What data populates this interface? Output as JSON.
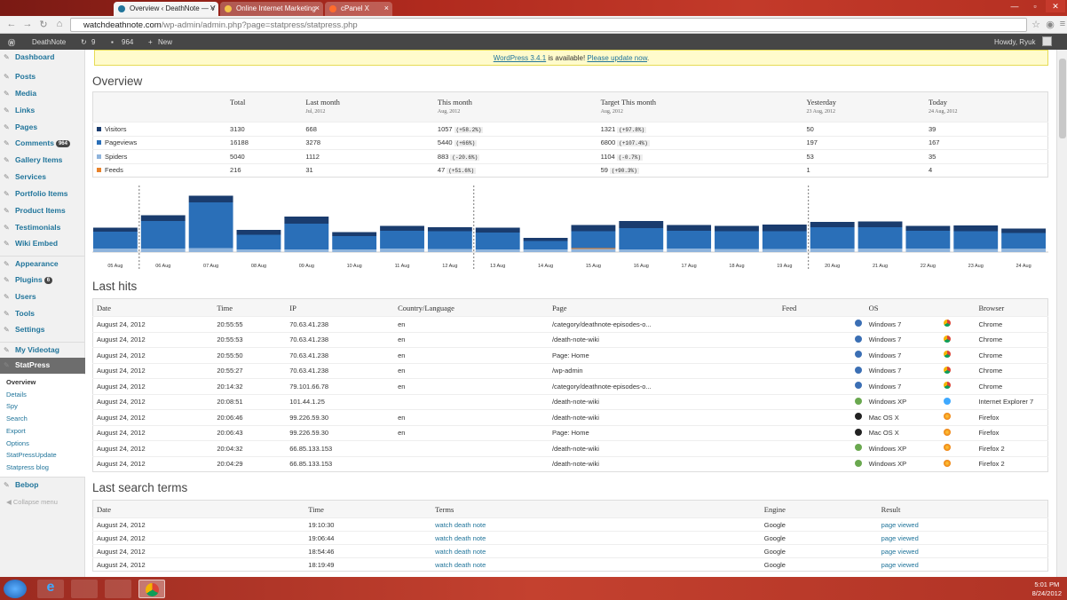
{
  "browser": {
    "tabs": [
      {
        "title": "Overview ‹ DeathNote — V"
      },
      {
        "title": "Online Internet Marketing"
      },
      {
        "title": "cPanel X"
      }
    ],
    "url_host": "watchdeathnote.com",
    "url_path": "/wp-admin/admin.php?page=statpress/statpress.php"
  },
  "adminbar": {
    "site": "DeathNote",
    "updates": "9",
    "comments": "964",
    "new": "New",
    "howdy": "Howdy, Ryuk"
  },
  "sidebar": {
    "items": [
      {
        "label": "Dashboard",
        "icon": "dashboard-icon"
      },
      {
        "label": "Posts",
        "icon": "pin-icon"
      },
      {
        "label": "Media",
        "icon": "media-icon"
      },
      {
        "label": "Links",
        "icon": "links-icon"
      },
      {
        "label": "Pages",
        "icon": "pages-icon"
      },
      {
        "label": "Comments",
        "icon": "comments-icon",
        "badge": "964"
      },
      {
        "label": "Gallery Items",
        "icon": "pin-icon"
      },
      {
        "label": "Services",
        "icon": "pin-icon"
      },
      {
        "label": "Portfolio Items",
        "icon": "pin-icon"
      },
      {
        "label": "Product Items",
        "icon": "pin-icon"
      },
      {
        "label": "Testimonials",
        "icon": "pin-icon"
      },
      {
        "label": "Wiki Embed",
        "icon": "wiki-icon"
      },
      {
        "label": "Appearance",
        "icon": "appearance-icon"
      },
      {
        "label": "Plugins",
        "icon": "plugins-icon",
        "badge": "6"
      },
      {
        "label": "Users",
        "icon": "users-icon"
      },
      {
        "label": "Tools",
        "icon": "tools-icon"
      },
      {
        "label": "Settings",
        "icon": "settings-icon"
      },
      {
        "label": "My Videotag",
        "icon": "video-icon"
      },
      {
        "label": "StatPress",
        "icon": "statpress-icon"
      },
      {
        "label": "Bebop",
        "icon": "bebop-icon"
      }
    ],
    "submenu": [
      "Overview",
      "Details",
      "Spy",
      "Search",
      "Export",
      "Options",
      "StatPressUpdate",
      "Statpress blog"
    ],
    "collapse": "Collapse menu"
  },
  "notice": {
    "link1": "WordPress 3.4.1",
    "mid": " is available! ",
    "link2": "Please update now",
    "end": "."
  },
  "overview": {
    "title": "Overview",
    "headers": [
      {
        "label": "",
        "sub": ""
      },
      {
        "label": "Total",
        "sub": ""
      },
      {
        "label": "Last month",
        "sub": "Jul, 2012"
      },
      {
        "label": "This month",
        "sub": "Aug, 2012"
      },
      {
        "label": "Target This month",
        "sub": "Aug, 2012"
      },
      {
        "label": "Yesterday",
        "sub": "23 Aug, 2012"
      },
      {
        "label": "Today",
        "sub": "24 Aug, 2012"
      }
    ],
    "rows": [
      {
        "name": "Visitors",
        "color": "#1a3c6e",
        "total": "3130",
        "last": "668",
        "this": "1057",
        "this_pct": "(+58.2%)",
        "target": "1321",
        "target_pct": "(+97.8%)",
        "yest": "50",
        "today": "39"
      },
      {
        "name": "Pageviews",
        "color": "#2a6fb8",
        "total": "16188",
        "last": "3278",
        "this": "5440",
        "this_pct": "(+66%)",
        "target": "6800",
        "target_pct": "(+107.4%)",
        "yest": "197",
        "today": "167"
      },
      {
        "name": "Spiders",
        "color": "#8fb4dc",
        "total": "5040",
        "last": "1112",
        "this": "883",
        "this_pct": "(-20.6%)",
        "target": "1104",
        "target_pct": "(-0.7%)",
        "yest": "53",
        "today": "35"
      },
      {
        "name": "Feeds",
        "color": "#e8822a",
        "total": "216",
        "last": "31",
        "this": "47",
        "this_pct": "(+51.6%)",
        "target": "59",
        "target_pct": "(+90.3%)",
        "yest": "1",
        "today": "4"
      }
    ]
  },
  "chart_data": {
    "type": "bar",
    "categories": [
      "05 Aug",
      "06 Aug",
      "07 Aug",
      "08 Aug",
      "09 Aug",
      "10 Aug",
      "11 Aug",
      "12 Aug",
      "13 Aug",
      "14 Aug",
      "15 Aug",
      "16 Aug",
      "17 Aug",
      "18 Aug",
      "19 Aug",
      "20 Aug",
      "21 Aug",
      "22 Aug",
      "23 Aug",
      "24 Aug"
    ],
    "series": [
      {
        "name": "Visitors",
        "color": "#1a3c6e",
        "values": [
          9,
          13,
          15,
          11,
          16,
          9,
          11,
          9,
          11,
          7,
          14,
          16,
          13,
          12,
          15,
          12,
          13,
          11,
          13,
          10
        ]
      },
      {
        "name": "Pageviews",
        "color": "#2a6fb8",
        "values": [
          38,
          62,
          103,
          33,
          58,
          30,
          40,
          40,
          38,
          19,
          38,
          48,
          40,
          40,
          40,
          48,
          48,
          40,
          40,
          35
        ]
      },
      {
        "name": "Spiders",
        "color": "#8fb4dc",
        "values": [
          8,
          8,
          9,
          6,
          6,
          6,
          8,
          7,
          6,
          6,
          7,
          6,
          8,
          7,
          7,
          8,
          8,
          8,
          7,
          8
        ]
      },
      {
        "name": "Feeds",
        "color": "#e8822a",
        "values": [
          0,
          0,
          0,
          0,
          0,
          0,
          0,
          0,
          0,
          0,
          2,
          0,
          0,
          0,
          0,
          0,
          0,
          0,
          0,
          0
        ]
      }
    ],
    "week_separators_after": [
      "05 Aug",
      "12 Aug",
      "19 Aug"
    ]
  },
  "last_hits": {
    "title": "Last hits",
    "headers": [
      "Date",
      "Time",
      "IP",
      "Country/Language",
      "Page",
      "Feed",
      "OS",
      "",
      "Browser"
    ],
    "rows": [
      {
        "date": "August 24, 2012",
        "time": "20:55:55",
        "ip": "70.63.41.238",
        "lang": "en",
        "page": "/category/deathnote-episodes-o...",
        "os": "Windows 7",
        "os_icon": "win7",
        "browser": "Chrome"
      },
      {
        "date": "August 24, 2012",
        "time": "20:55:53",
        "ip": "70.63.41.238",
        "lang": "en",
        "page": "/death-note-wiki",
        "os": "Windows 7",
        "os_icon": "win7",
        "browser": "Chrome"
      },
      {
        "date": "August 24, 2012",
        "time": "20:55:50",
        "ip": "70.63.41.238",
        "lang": "en",
        "page": "Page: Home",
        "os": "Windows 7",
        "os_icon": "win7",
        "browser": "Chrome"
      },
      {
        "date": "August 24, 2012",
        "time": "20:55:27",
        "ip": "70.63.41.238",
        "lang": "en",
        "page": "/wp-admin",
        "os": "Windows 7",
        "os_icon": "win7",
        "browser": "Chrome"
      },
      {
        "date": "August 24, 2012",
        "time": "20:14:32",
        "ip": "79.101.66.78",
        "lang": "en",
        "page": "/category/deathnote-episodes-o...",
        "os": "Windows 7",
        "os_icon": "win7",
        "browser": "Chrome"
      },
      {
        "date": "August 24, 2012",
        "time": "20:08:51",
        "ip": "101.44.1.25",
        "lang": "",
        "page": "/death-note-wiki",
        "os": "Windows XP",
        "os_icon": "winxp",
        "browser": "Internet Explorer 7"
      },
      {
        "date": "August 24, 2012",
        "time": "20:06:46",
        "ip": "99.226.59.30",
        "lang": "en",
        "page": "/death-note-wiki",
        "os": "Mac OS X",
        "os_icon": "mac",
        "browser": "Firefox"
      },
      {
        "date": "August 24, 2012",
        "time": "20:06:43",
        "ip": "99.226.59.30",
        "lang": "en",
        "page": "Page: Home",
        "os": "Mac OS X",
        "os_icon": "mac",
        "browser": "Firefox"
      },
      {
        "date": "August 24, 2012",
        "time": "20:04:32",
        "ip": "66.85.133.153",
        "lang": "",
        "page": "/death-note-wiki",
        "os": "Windows XP",
        "os_icon": "winxp",
        "browser": "Firefox 2"
      },
      {
        "date": "August 24, 2012",
        "time": "20:04:29",
        "ip": "66.85.133.153",
        "lang": "",
        "page": "/death-note-wiki",
        "os": "Windows XP",
        "os_icon": "winxp",
        "browser": "Firefox 2"
      }
    ]
  },
  "search_terms": {
    "title": "Last search terms",
    "headers": [
      "Date",
      "Time",
      "Terms",
      "Engine",
      "Result"
    ],
    "rows": [
      {
        "date": "August 24, 2012",
        "time": "19:10:30",
        "terms": "watch death note",
        "engine": "Google",
        "result": "page viewed"
      },
      {
        "date": "August 24, 2012",
        "time": "19:06:44",
        "terms": "watch death note",
        "engine": "Google",
        "result": "page viewed"
      },
      {
        "date": "August 24, 2012",
        "time": "18:54:46",
        "terms": "watch death note",
        "engine": "Google",
        "result": "page viewed"
      },
      {
        "date": "August 24, 2012",
        "time": "18:19:49",
        "terms": "watch death note",
        "engine": "Google",
        "result": "page viewed"
      }
    ]
  },
  "taskbar": {
    "time": "5:01 PM",
    "date": "8/24/2012"
  }
}
